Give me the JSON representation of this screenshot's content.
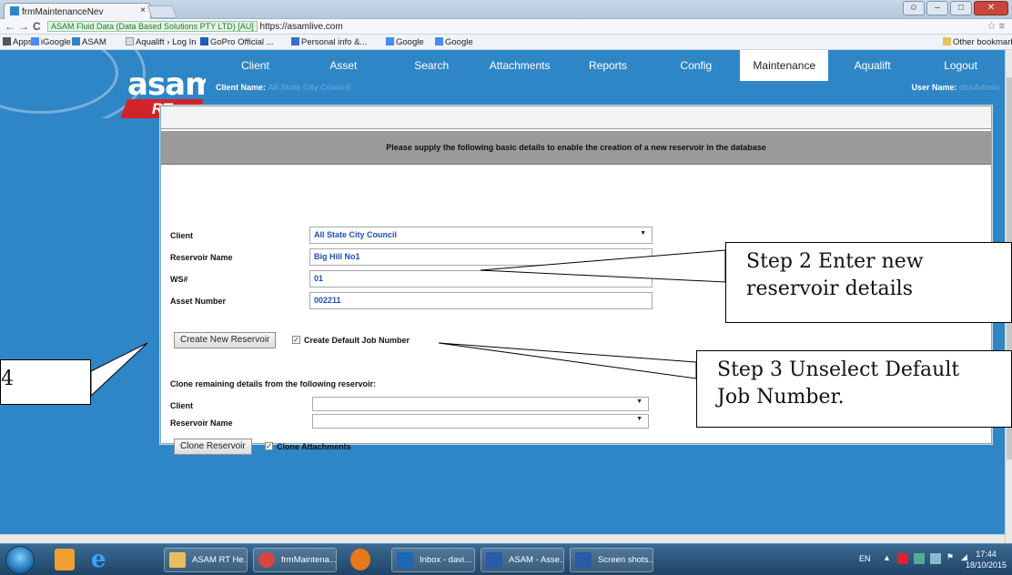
{
  "browser": {
    "tab_title": "frmMaintenanceNev",
    "tab_close": "×",
    "url_ssl_label": "ASAM Fluid Data (Data Based Solutions PTY LTD) [AU]",
    "url": "https://asamlive.com",
    "back": "←",
    "forward": "→",
    "reload": "C",
    "bookmarks": [
      "Apps",
      "iGoogle",
      "ASAM",
      "Aqualift › Log In",
      "GoPro Official ...",
      "Personal info &...",
      "Google",
      "Google"
    ],
    "other_bookmarks": "Other bookmarks"
  },
  "app": {
    "logo_text": "asam",
    "logo_sub": "RT",
    "nav": [
      "Client",
      "Asset",
      "Search",
      "Attachments",
      "Reports",
      "Config",
      "Maintenance",
      "Aqualift",
      "Logout"
    ],
    "active_nav": "Maintenance",
    "client_name_label": "Client Name:",
    "client_name_value": "All State City Council",
    "user_name_label": "User Name:",
    "user_name_value": "dbsAdmin"
  },
  "form": {
    "banner": "Please supply the following basic details to enable the creation of a new reservoir in the database",
    "client_label": "Client",
    "client_value": "All State City Council",
    "reservoir_name_label": "Reservoir Name",
    "reservoir_name_value": "Big Hill No1",
    "ws_label": "WS#",
    "ws_value": "01",
    "asset_number_label": "Asset Number",
    "asset_number_value": "002211",
    "create_button": "Create New Reservoir",
    "create_default_job_label": "Create Default Job Number",
    "create_default_job_checked": true,
    "clone_heading": "Clone remaining details from the following reservoir:",
    "clone_client_label": "Client",
    "clone_client_value": "",
    "clone_reservoir_label": "Reservoir Name",
    "clone_reservoir_value": "",
    "clone_button": "Clone Reservoir",
    "clone_attachments_label": "Clone Attachments",
    "clone_attachments_checked": true
  },
  "callouts": {
    "step2": [
      "Step 2 Enter new",
      "reservoir details"
    ],
    "step3": [
      "Step 3 Unselect Default",
      "Job Number."
    ],
    "step4": "4"
  },
  "taskbar": {
    "items": [
      "ASAM RT He...",
      "frmMaintena...",
      "Inbox - davi...",
      "ASAM - Asse...",
      "Screen shots..."
    ],
    "lang": "EN",
    "time": "17:44",
    "date": "18/10/2015"
  },
  "colors": {
    "app_blue": "#2f86c6",
    "logo_red": "#d3232a",
    "field_text": "#1f4fb8",
    "banner_gray": "#9a9a9a"
  }
}
